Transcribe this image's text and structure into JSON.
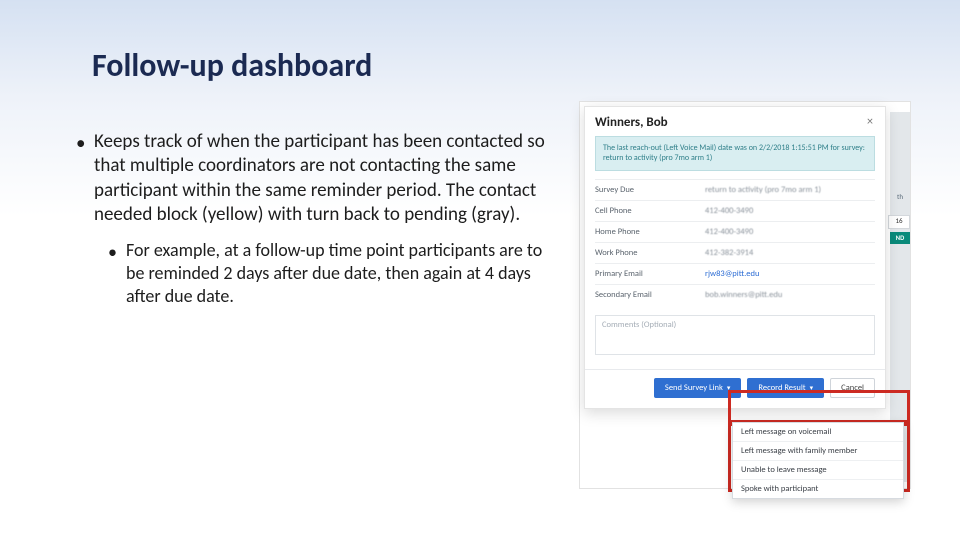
{
  "slide": {
    "title": "Follow-up dashboard",
    "bullets": {
      "main": "Keeps track of when the participant has been contacted so that multiple coordinators are not contacting the same participant within the same reminder period. The contact needed block (yellow) with turn back to pending (gray).",
      "sub": "For example, at a follow-up time point participants are to be reminded 2 days after due date, then again at 4 days after due date."
    }
  },
  "modal": {
    "title": "Winners, Bob",
    "close": "×",
    "banner": "The last reach-out (Left Voice Mail) date was on 2/2/2018 1:15:51 PM for survey: return to activity (pro 7mo arm 1)",
    "rows": [
      {
        "label": "Survey Due",
        "value": "return to activity (pro 7mo arm 1)"
      },
      {
        "label": "Cell Phone",
        "value": "412-400-3490"
      },
      {
        "label": "Home Phone",
        "value": "412-400-3490"
      },
      {
        "label": "Work Phone",
        "value": "412-382-3914"
      },
      {
        "label": "Primary Email",
        "value": "rjw83@pitt.edu",
        "link": true
      },
      {
        "label": "Secondary Email",
        "value": "bob.winners@pitt.edu"
      }
    ],
    "comments_placeholder": "Comments (Optional)",
    "buttons": {
      "send": "Send Survey Link",
      "record": "Record Result",
      "cancel": "Cancel"
    },
    "dropdown_items": [
      "Left message on voicemail",
      "Left message with family member",
      "Unable to leave message",
      "Spoke with participant"
    ]
  },
  "behind": {
    "th": "th",
    "n16": "16",
    "nd": "ND"
  }
}
